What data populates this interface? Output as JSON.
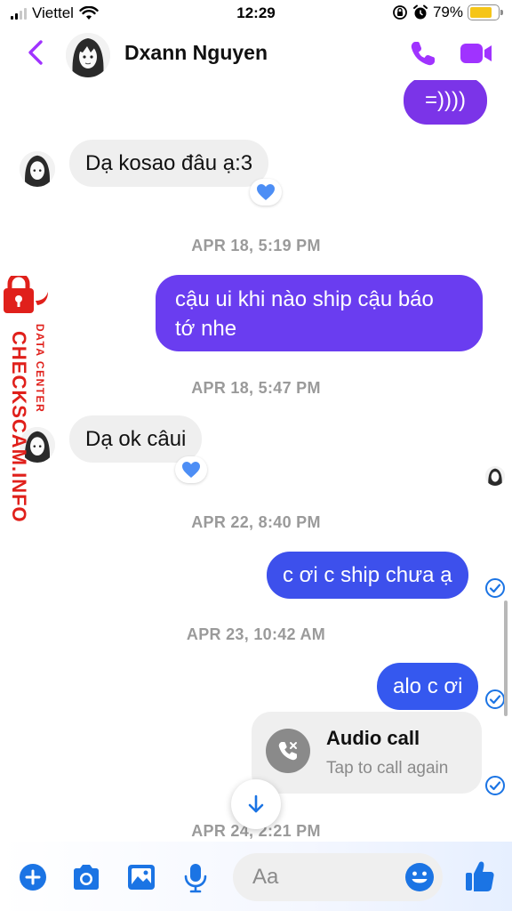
{
  "status": {
    "carrier": "Viettel",
    "time": "12:29",
    "battery": "79%",
    "battery_level": 0.79
  },
  "header": {
    "contact_name": "Dxann Nguyen",
    "icons": [
      "back-chevron-icon",
      "avatar",
      "phone-icon",
      "video-camera-icon"
    ]
  },
  "messages": {
    "m1": {
      "text": "=))))",
      "dir": "out"
    },
    "m2": {
      "text": "Dạ kosao đâu ạ:3",
      "dir": "in",
      "reaction": "blue-heart"
    },
    "ts1": "APR 18, 5:19 PM",
    "m3": {
      "line1": "cậu ui khi nào ship cậu báo",
      "line2": "tớ nhe",
      "dir": "out"
    },
    "ts2": "APR 18, 5:47 PM",
    "m4": {
      "text": "Dạ ok câui",
      "dir": "in",
      "reaction": "blue-heart"
    },
    "ts3": "APR 22, 8:40 PM",
    "m5": {
      "text": "c ơi c ship chưa ạ",
      "dir": "out"
    },
    "ts4": "APR 23, 10:42 AM",
    "m6": {
      "text": "alo c ơi",
      "dir": "out"
    },
    "call": {
      "title": "Audio call",
      "subtitle": "Tap to call again"
    },
    "ts5": "APR 24, 2:21 PM"
  },
  "watermark": {
    "main": "CHECKSCAM.INFO",
    "sub": "DATA CENTER"
  },
  "composer": {
    "placeholder": "Aa",
    "icons": [
      "plus-icon",
      "camera-icon",
      "image-icon",
      "mic-icon",
      "emoji-icon",
      "thumbs-up-icon"
    ]
  },
  "colors": {
    "accent_purple": "#a033ff",
    "bubble_purple": "#7b34e8",
    "bubble_blue": "#3b55ee",
    "icon_blue": "#1b74e4",
    "watermark_red": "#e0201b"
  }
}
